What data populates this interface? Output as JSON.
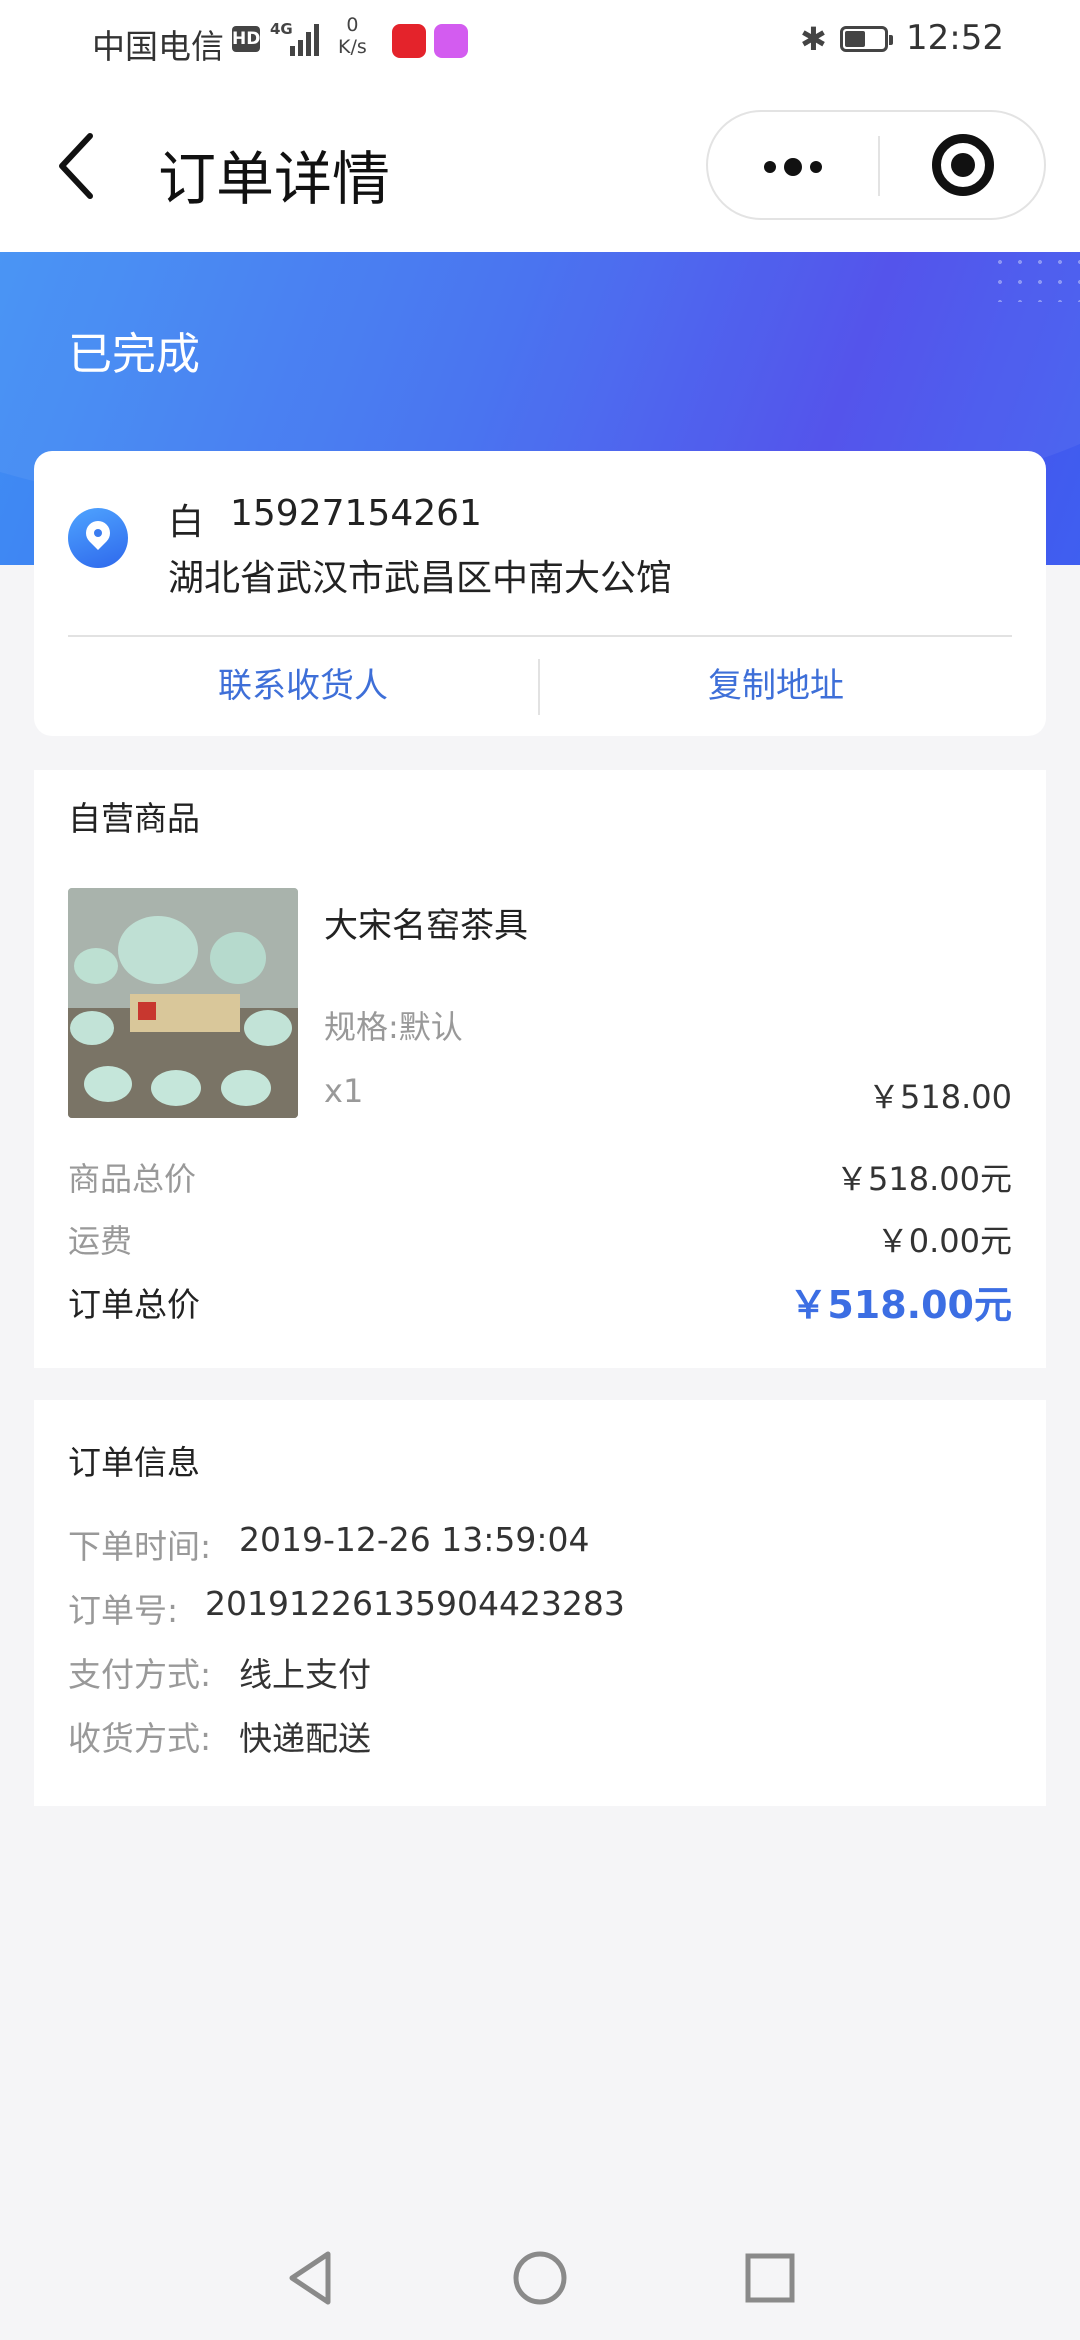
{
  "status_bar": {
    "carrier": "中国电信",
    "hd": "HD",
    "network": "4G",
    "speed_value": "0",
    "speed_unit": "K/s",
    "time": "12:52"
  },
  "nav": {
    "title": "订单详情"
  },
  "order_status": "已完成",
  "address": {
    "name": "白",
    "phone": "15927154261",
    "address_line": "湖北省武汉市武昌区中南大公馆",
    "contact_label": "联系收货人",
    "copy_label": "复制地址"
  },
  "goods_section": {
    "title": "自营商品",
    "item": {
      "name": "大宋名窑茶具",
      "spec": "规格:默认",
      "quantity": "x1",
      "price": "￥518.00"
    },
    "summary": {
      "subtotal_label": "商品总价",
      "subtotal_value": "￥518.00元",
      "shipping_label": "运费",
      "shipping_value": "￥0.00元",
      "total_label": "订单总价",
      "total_value": "￥518.00元"
    }
  },
  "order_info": {
    "title": "订单信息",
    "rows": [
      {
        "label": "下单时间:",
        "value": "2019-12-26 13:59:04"
      },
      {
        "label": "订单号:",
        "value": "20191226135904423283"
      },
      {
        "label": "支付方式:",
        "value": "线上支付"
      },
      {
        "label": "收货方式:",
        "value": "快递配送"
      }
    ]
  },
  "colors": {
    "accent": "#3e6fd8",
    "banner_start": "#3f8ff4",
    "banner_end": "#4a4aea",
    "background": "#f5f5f7"
  }
}
